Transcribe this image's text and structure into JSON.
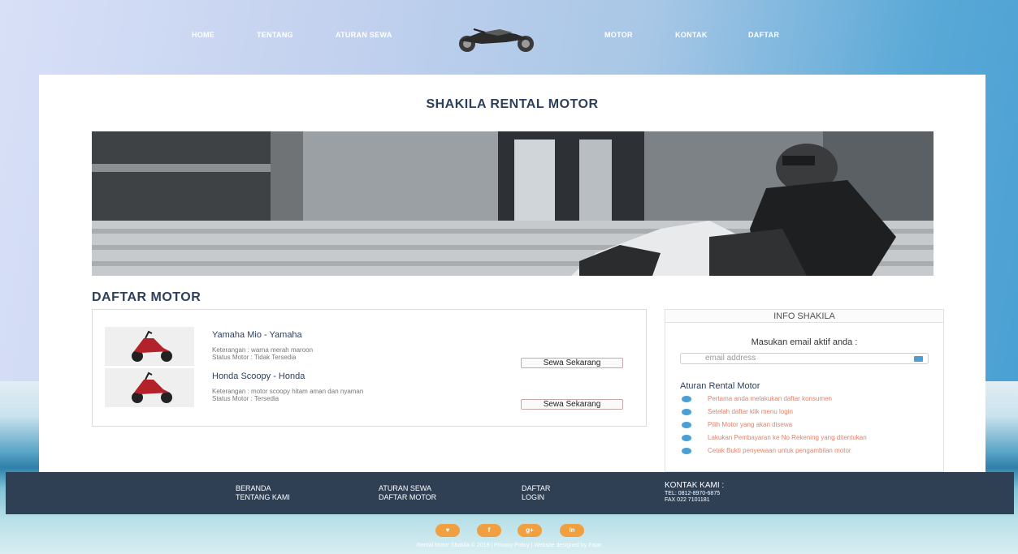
{
  "nav": {
    "home": "HOME",
    "tentang": "TENTANG",
    "aturan_sewa": "ATURAN SEWA",
    "motor": "MOTOR",
    "kontak": "KONTAK",
    "daftar": "DAFTAR"
  },
  "site_title": "SHAKILA RENTAL MOTOR",
  "section_title": "DAFTAR MOTOR",
  "motors": [
    {
      "name": "Yamaha Mio - Yamaha",
      "keterangan": "Keterangan : warna merah maroon",
      "status": "Status Motor : Tidak Tersedia",
      "button": "Sewa Sekarang"
    },
    {
      "name": "Honda Scoopy - Honda",
      "keterangan": "Keterangan : motor scoopy hitam aman dan nyaman",
      "status": "Status Motor : Tersedia",
      "button": "Sewa Sekarang"
    }
  ],
  "sidebar": {
    "header": "INFO SHAKILA",
    "subtitle": "Masukan email aktif anda :",
    "email_placeholder": "email address",
    "rules_title": "Aturan Rental Motor",
    "rules": [
      "Pertama anda melakukan daftar konsumen",
      "Setelah daftar klik menu login",
      "Pilih Motor yang akan disewa",
      "Lakukan Pembayaran ke No Rekening yang ditentukan",
      "Cetak Bukti penyewaan untuk pengambilan motor"
    ]
  },
  "footer": {
    "beranda": "BERANDA",
    "tentang_kami": "TENTANG KAMI",
    "aturan_sewa": "ATURAN SEWA",
    "daftar_motor": "DAFTAR MOTOR",
    "daftar": "DAFTAR",
    "login": "LOGIN",
    "kontak_title": "KONTAK KAMI :",
    "tel": "TEL: 0812-8970-6875",
    "fax": "FAX 022 7101181"
  },
  "social": {
    "twitter": "♥",
    "facebook": "f",
    "google": "g+",
    "linkedin": "in"
  },
  "copyright": "Rental Motor Shakila © 2019 | Privacy Policy | Website designed by Fajar",
  "colors": {
    "primary": "#2e3f5c",
    "accent": "#4aa0d3",
    "social": "#f0a040",
    "rule_text": "#e2826a"
  }
}
